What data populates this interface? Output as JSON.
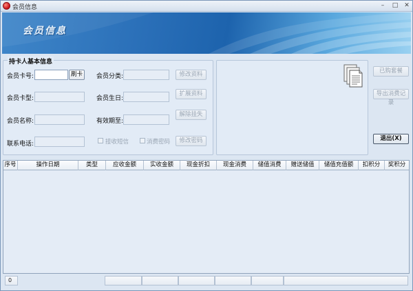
{
  "window": {
    "title": "会员信息"
  },
  "banner": {
    "title": "会员信息"
  },
  "group": {
    "legend": "持卡人基本信息"
  },
  "fields": {
    "card_no": {
      "label": "会员卡号:",
      "value": ""
    },
    "card_type": {
      "label": "会员卡型:",
      "value": ""
    },
    "name": {
      "label": "会员名称:",
      "value": ""
    },
    "phone": {
      "label": "联系电话:",
      "value": ""
    },
    "category": {
      "label": "会员分类:",
      "value": ""
    },
    "birthday": {
      "label": "会员生日:",
      "value": ""
    },
    "valid_until": {
      "label": "有效期至:",
      "value": ""
    }
  },
  "buttons": {
    "swipe": "刷卡",
    "edit_info": "修改资料",
    "extended_info": "扩展资料",
    "unfreeze": "解除挂失",
    "change_password": "修改密码",
    "packages": "已购套餐",
    "export_records": "导出消费记录",
    "exit": "退出(X)"
  },
  "checkboxes": {
    "receive_sms": "接收短信",
    "consume_password": "消费密码"
  },
  "icons": {
    "app": "red-orb-icon",
    "document": "document-stack-icon"
  },
  "table": {
    "columns": [
      "序号",
      "操作日期",
      "类型",
      "应收金额",
      "实收金额",
      "现金折扣",
      "现金消费",
      "储值消费",
      "赠送储值",
      "储值充值额",
      "扣积分",
      "奖积分"
    ],
    "rows": []
  },
  "status": {
    "count": "0"
  },
  "colors": {
    "banner_dark": "#1d63ad",
    "banner_light": "#9ad1f1",
    "window_bg": "#dce6f2"
  }
}
